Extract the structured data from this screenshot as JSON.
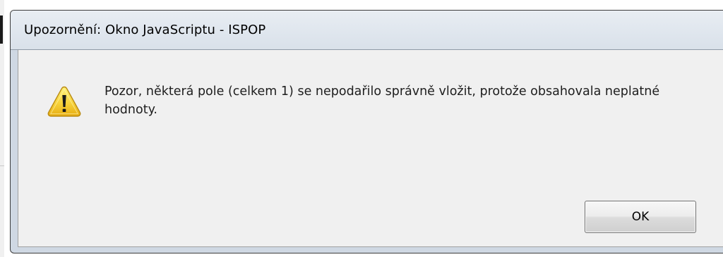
{
  "dialog": {
    "title": "Upozornění: Okno JavaScriptu - ISPOP",
    "icon": "warning-icon",
    "message": "Pozor, některá pole (celkem 1) se nepodařilo správně vložit, protože obsahovala neplatné hodnoty.",
    "ok_label": "OK"
  }
}
